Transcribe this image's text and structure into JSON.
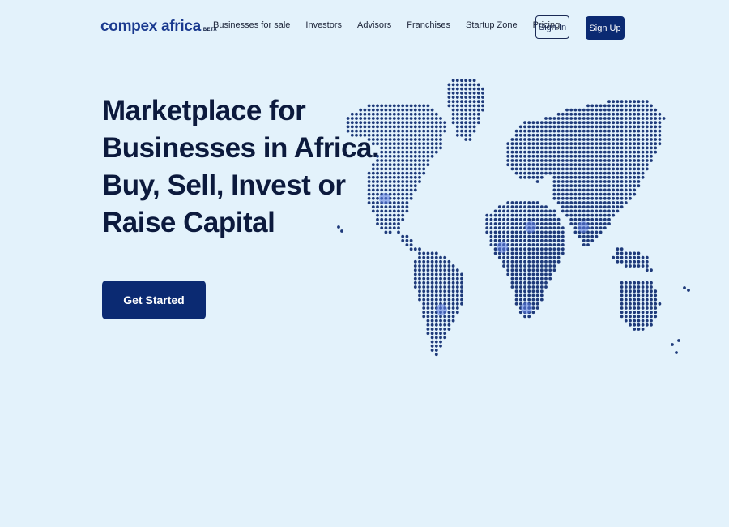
{
  "header": {
    "logo_text": "compex africa",
    "logo_badge": "BETA",
    "nav": [
      {
        "label": "Businesses for sale"
      },
      {
        "label": "Investors"
      },
      {
        "label": "Advisors"
      },
      {
        "label": "Franchises"
      },
      {
        "label": "Startup Zone"
      },
      {
        "label": "Pricing"
      }
    ],
    "sign_in": "Sign In",
    "sign_up": "Sign Up"
  },
  "hero": {
    "title_lines": [
      "Marketplace for",
      "Businesses in Africa.",
      "Buy, Sell, Invest or",
      "Raise Capital"
    ],
    "cta": "Get Started"
  },
  "colors": {
    "background": "#e3f2fb",
    "primary": "#0b2a72",
    "dot": "#1e3a7a",
    "highlight": "#5c7ce0"
  },
  "map": {
    "icon": "world-dot-map-illustration"
  }
}
